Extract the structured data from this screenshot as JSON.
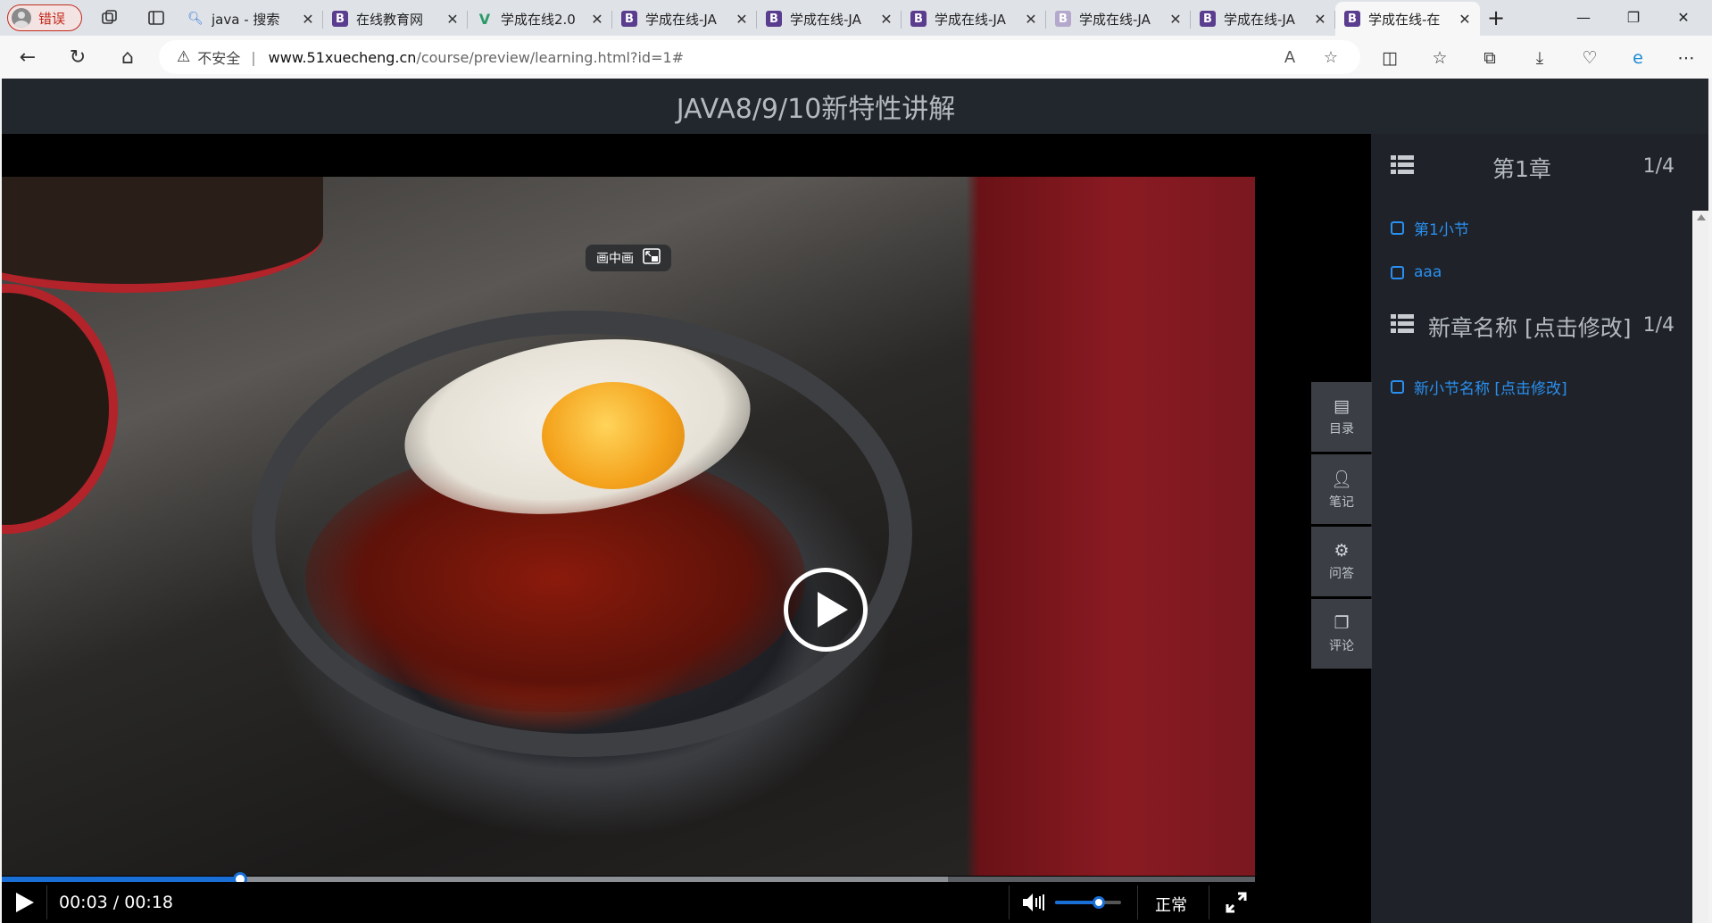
{
  "browser": {
    "profile_label": "错误",
    "tabs": [
      {
        "title": "java - 搜索",
        "favicon": "search-icon"
      },
      {
        "title": "在线教育网",
        "favicon": "bootstrap-icon"
      },
      {
        "title": "学成在线2.0",
        "favicon": "vue-icon"
      },
      {
        "title": "学成在线-JA",
        "favicon": "bootstrap-icon"
      },
      {
        "title": "学成在线-JA",
        "favicon": "bootstrap-icon"
      },
      {
        "title": "学成在线-JA",
        "favicon": "bootstrap-icon"
      },
      {
        "title": "学成在线-JA",
        "favicon": "bootstrap-icon"
      },
      {
        "title": "学成在线-JA",
        "favicon": "bootstrap-icon"
      },
      {
        "title": "学成在线-在",
        "favicon": "bootstrap-icon",
        "active": true
      }
    ],
    "address": {
      "security_label": "不安全",
      "url_host": "www.51xuecheng.cn",
      "url_path": "/course/preview/learning.html?id=1#"
    }
  },
  "course": {
    "title": "JAVA8/9/10新特性讲解"
  },
  "player": {
    "pip_label": "画中画",
    "time_display": "00:03 / 00:18",
    "progress_played": 0.19,
    "progress_buffered": 0.755,
    "volume_level": 0.66,
    "speed_label": "正常"
  },
  "side_tools": [
    {
      "label": "目录",
      "icon": "catalog-icon"
    },
    {
      "label": "笔记",
      "icon": "user-icon"
    },
    {
      "label": "问答",
      "icon": "gear-icon"
    },
    {
      "label": "评论",
      "icon": "copy-icon"
    }
  ],
  "chapters": [
    {
      "title": "第1章",
      "count": "1/4",
      "sections": [
        "第1小节",
        "aaa"
      ]
    },
    {
      "title": "新章名称 [点击修改]",
      "count": "1/4",
      "sections": [
        "新小节名称 [点击修改]"
      ]
    }
  ],
  "colors": {
    "accent": "#1a6fd6",
    "link": "#2a8ff0",
    "page_bg": "#1f2329"
  }
}
